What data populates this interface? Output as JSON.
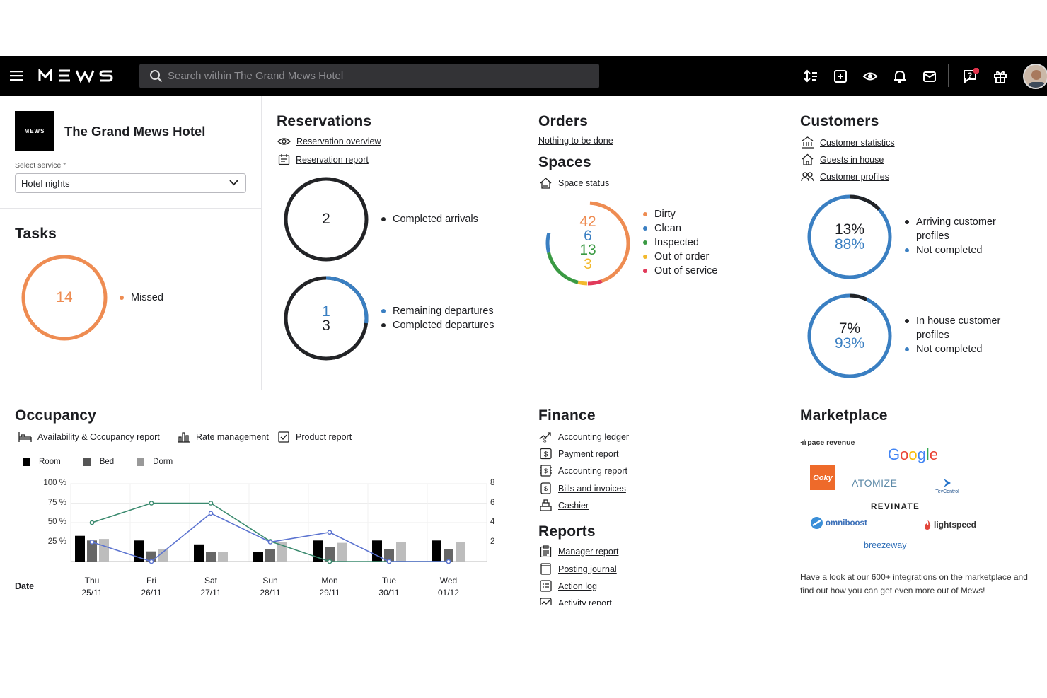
{
  "colors": {
    "accent": "#3a7fc2",
    "orange": "#ee8c52",
    "green": "#3a9a43",
    "yellow": "#f2b92d",
    "red": "#e13a5a",
    "dark": "#222326"
  },
  "header": {
    "logo": "MEWS",
    "search_placeholder": "Search within The Grand Mews Hotel",
    "icons": [
      "menu-icon",
      "sort-icon",
      "add-icon",
      "eye-icon",
      "bell-icon",
      "mail-icon",
      "help-icon",
      "gift-icon"
    ]
  },
  "property": {
    "logo_text": "MEWS",
    "name": "The Grand Mews Hotel",
    "service_label": "Select service",
    "service_required": "*",
    "service_value": "Hotel nights"
  },
  "tasks": {
    "title": "Tasks",
    "value": "14",
    "legend": [
      {
        "label": "Missed",
        "color": "#ee8c52"
      }
    ]
  },
  "reservations": {
    "title": "Reservations",
    "links": [
      "Reservation overview",
      "Reservation report"
    ],
    "arrivals": {
      "value": "2",
      "legend": "Completed arrivals"
    },
    "departures": {
      "remaining": "1",
      "completed": "3",
      "legend": [
        "Remaining departures",
        "Completed departures"
      ]
    }
  },
  "orders": {
    "title": "Orders",
    "link": "Nothing to be done"
  },
  "spaces": {
    "title": "Spaces",
    "link": "Space status",
    "counts": [
      "42",
      "6",
      "13",
      "3"
    ],
    "legend": [
      {
        "label": "Dirty",
        "color": "#ee8c52"
      },
      {
        "label": "Clean",
        "color": "#3a7fc2"
      },
      {
        "label": "Inspected",
        "color": "#3a9a43"
      },
      {
        "label": "Out of order",
        "color": "#f2b92d"
      },
      {
        "label": "Out of service",
        "color": "#e13a5a"
      }
    ]
  },
  "customers": {
    "title": "Customers",
    "links": [
      "Customer statistics",
      "Guests in house",
      "Customer profiles"
    ],
    "arriving": {
      "pct_a": "13%",
      "pct_b": "88%",
      "legend": [
        "Arriving customer profiles",
        "Not completed"
      ],
      "fraction": 0.13
    },
    "in_house": {
      "pct_a": "7%",
      "pct_b": "93%",
      "legend": [
        "In house customer profiles",
        "Not completed"
      ],
      "fraction": 0.07
    }
  },
  "occupancy": {
    "title": "Occupancy",
    "links": [
      "Availability & Occupancy report",
      "Rate management",
      "Product report"
    ],
    "date_label": "Date"
  },
  "chart_data": {
    "type": "bar",
    "categories": [
      "Thu 25/11",
      "Fri 26/11",
      "Sat 27/11",
      "Sun 28/11",
      "Mon 29/11",
      "Tue 30/11",
      "Wed 01/12"
    ],
    "category_lines": [
      [
        "Thu",
        "25/11"
      ],
      [
        "Fri",
        "26/11"
      ],
      [
        "Sat",
        "27/11"
      ],
      [
        "Sun",
        "28/11"
      ],
      [
        "Mon",
        "29/11"
      ],
      [
        "Tue",
        "30/11"
      ],
      [
        "Wed",
        "01/12"
      ]
    ],
    "series": [
      {
        "name": "Room",
        "kind": "bar",
        "color": "#000000",
        "values": [
          33,
          27,
          22,
          12,
          27,
          27,
          27
        ]
      },
      {
        "name": "Bed",
        "kind": "bar",
        "color": "#666666",
        "values": [
          27,
          13,
          12,
          16,
          19,
          16,
          16
        ]
      },
      {
        "name": "Dorm",
        "kind": "bar",
        "color": "#bdbdbd",
        "values": [
          29,
          16,
          12,
          25,
          24,
          25,
          25
        ]
      },
      {
        "kind": "line",
        "color": "#3a8a6e",
        "values": [
          50,
          75,
          75,
          26,
          0,
          0,
          0
        ]
      },
      {
        "kind": "line",
        "color": "#5b73d0",
        "values": [
          25,
          0,
          62,
          25,
          37.5,
          0,
          0
        ]
      }
    ],
    "ylim": [
      0,
      100
    ],
    "left_ticks": [
      "100 %",
      "75 %",
      "50 %",
      "25 %"
    ],
    "left_tick_values": [
      100,
      75,
      50,
      25
    ],
    "right_ticks": [
      "8",
      "6",
      "4",
      "2"
    ],
    "right_tick_values": [
      8,
      6,
      4,
      2
    ],
    "grid": true,
    "legend": "top-left"
  },
  "finance": {
    "title": "Finance",
    "links": [
      "Accounting ledger",
      "Payment report",
      "Accounting report",
      "Bills and invoices",
      "Cashier"
    ]
  },
  "reports": {
    "title": "Reports",
    "links": [
      "Manager report",
      "Posting journal",
      "Action log",
      "Activity report"
    ]
  },
  "marketplace": {
    "title": "Marketplace",
    "partners": [
      "pace revenue",
      "Google",
      "Ooky",
      "ATOMIZE",
      "TevControl",
      "REVINATE",
      "omniboost",
      "lightspeed",
      "breezeway"
    ],
    "text": "Have a look at our 600+ integrations on the marketplace and find out how you can get even more out of Mews!"
  }
}
